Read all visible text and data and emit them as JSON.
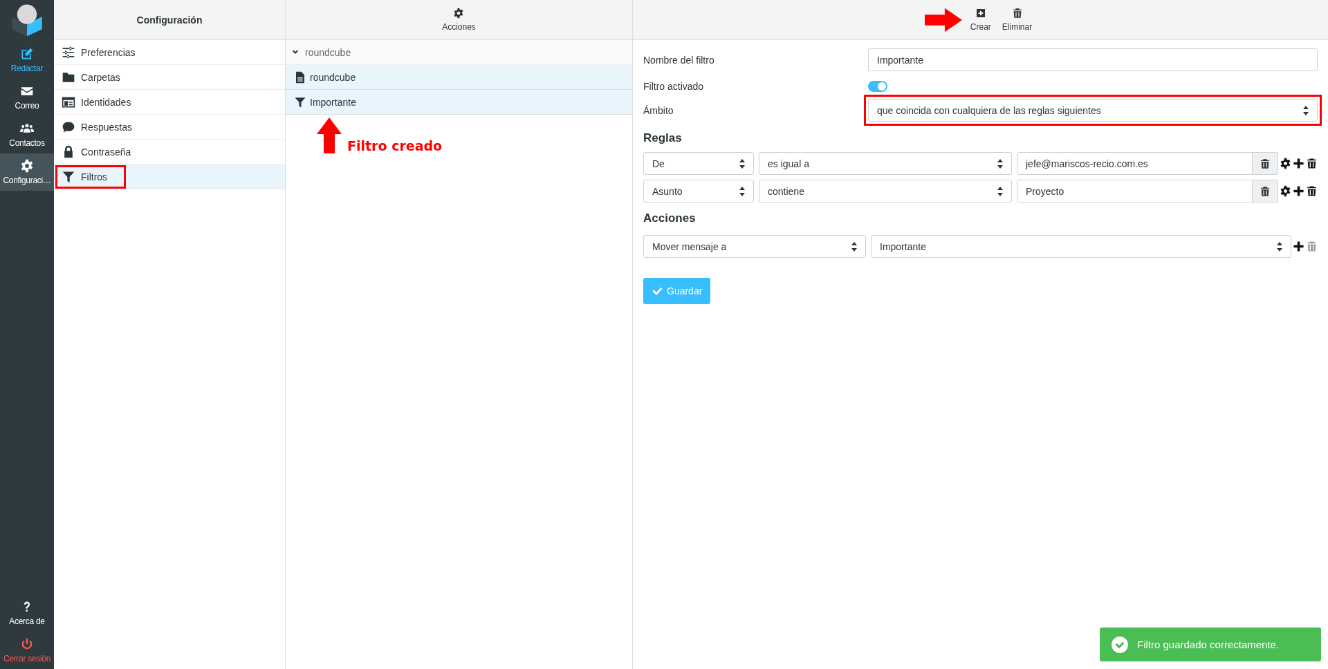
{
  "sidebar": {
    "items": [
      {
        "label": "Redactar",
        "kind": "compose",
        "selected": false
      },
      {
        "label": "Correo",
        "kind": "mail",
        "selected": false
      },
      {
        "label": "Contactos",
        "kind": "contacts",
        "selected": false
      },
      {
        "label": "Configuraci…",
        "kind": "settings",
        "selected": true
      }
    ],
    "footer_items": [
      {
        "label": "Acerca de",
        "kind": "about"
      },
      {
        "label": "Cerrar sesión",
        "kind": "logout"
      }
    ]
  },
  "settings_panel": {
    "title": "Configuración",
    "items": [
      {
        "label": "Preferencias",
        "kind": "sliders",
        "selected": false,
        "highlighted": false
      },
      {
        "label": "Carpetas",
        "kind": "folder",
        "selected": false,
        "highlighted": false
      },
      {
        "label": "Identidades",
        "kind": "idcard",
        "selected": false,
        "highlighted": false
      },
      {
        "label": "Respuestas",
        "kind": "comment",
        "selected": false,
        "highlighted": false
      },
      {
        "label": "Contraseña",
        "kind": "lock",
        "selected": false,
        "highlighted": false
      },
      {
        "label": "Filtros",
        "kind": "funnel",
        "selected": true,
        "highlighted": true
      }
    ]
  },
  "filters_panel": {
    "toolbar_label": "Acciones",
    "group": {
      "label": "roundcube",
      "expanded": true
    },
    "items": [
      {
        "label": "roundcube",
        "kind": "filterset",
        "selected": true
      },
      {
        "label": "Importante",
        "kind": "filter",
        "selected": true
      }
    ],
    "annotation": "Filtro creado"
  },
  "editor": {
    "toolbar": [
      {
        "label": "Crear",
        "kind": "create",
        "pointed": true
      },
      {
        "label": "Eliminar",
        "kind": "delete",
        "pointed": false
      }
    ],
    "name_label": "Nombre del filtro",
    "name_value": "Importante",
    "active_label": "Filtro activado",
    "active_on": true,
    "scope_label": "Ámbito",
    "scope_value": "que coincida con cualquiera de las reglas siguientes",
    "scope_highlighted": true,
    "rules_heading": "Reglas",
    "rules": [
      {
        "header": "De",
        "operator": "es igual a",
        "value": "jefe@mariscos-recio.com.es",
        "can_delete": true
      },
      {
        "header": "Asunto",
        "operator": "contiene",
        "value": "Proyecto",
        "can_delete": true
      }
    ],
    "actions_heading": "Acciones",
    "actions": [
      {
        "type": "Mover mensaje a",
        "target": "Importante",
        "can_delete": false
      }
    ],
    "save_label": "Guardar"
  },
  "toast": {
    "text": "Filtro guardado correctamente."
  }
}
